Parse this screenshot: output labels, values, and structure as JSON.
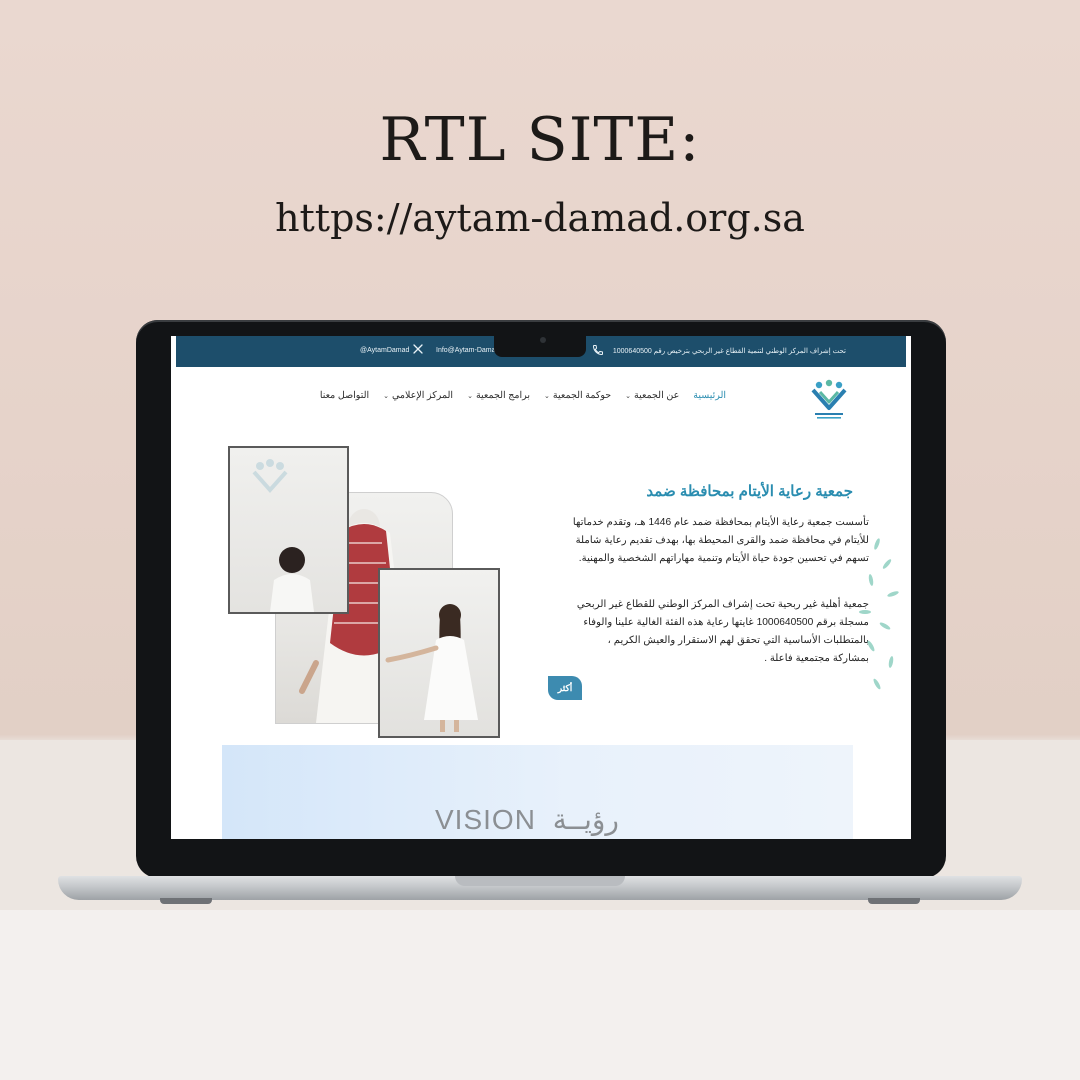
{
  "poster": {
    "title": "RTL SITE:",
    "url": "https://aytam-damad.org.sa"
  },
  "website": {
    "topbar": {
      "notice": "تحت إشراف المركز الوطني لتنمية القطاع غير الربحي بترخيص رقم 1000640500",
      "phone": "",
      "email": "Info@Aytam-Damad",
      "handle": "@AytamDamad"
    },
    "nav": {
      "items": [
        {
          "label": "الرئيسية",
          "active": true,
          "dropdown": false
        },
        {
          "label": "عن الجمعية",
          "active": false,
          "dropdown": true
        },
        {
          "label": "حوكمة الجمعية",
          "active": false,
          "dropdown": true
        },
        {
          "label": "برامج الجمعية",
          "active": false,
          "dropdown": true
        },
        {
          "label": "المركز الإعلامي",
          "active": false,
          "dropdown": true
        },
        {
          "label": "التواصل معنا",
          "active": false,
          "dropdown": false
        }
      ]
    },
    "hero": {
      "title": "جمعية رعاية الأيتام بمحافظة ضمد",
      "paragraph1": "تأسست جمعية رعاية الأيتام بمحافظة ضمد عام 1446 هـ، وتقدم خدماتها للأيتام في محافظة ضمد والقرى المحيطة بها، بهدف تقديم رعاية شاملة تسهم في تحسين جودة حياة الأيتام وتنمية مهاراتهم الشخصية والمهنية.",
      "paragraph2": "جمعية أهلية غير ربحية تحت إشراف المركز الوطني للقطاع غير الربحي مسجلة برقم 1000640500 غايتها رعاية هذه الفئة الغالية علينا والوفاء بالمتطلبات الأساسية التي تحقق لهم الاستقرار والعيش الكريم ، بمشاركة مجتمعية فاعلة .",
      "more_label": "أكثر"
    },
    "vision": {
      "arabic": "رؤيــة",
      "english": "VISION"
    },
    "colors": {
      "topbar": "#1d4e6b",
      "accent": "#2a8db0",
      "button": "#3d8bb0"
    }
  }
}
